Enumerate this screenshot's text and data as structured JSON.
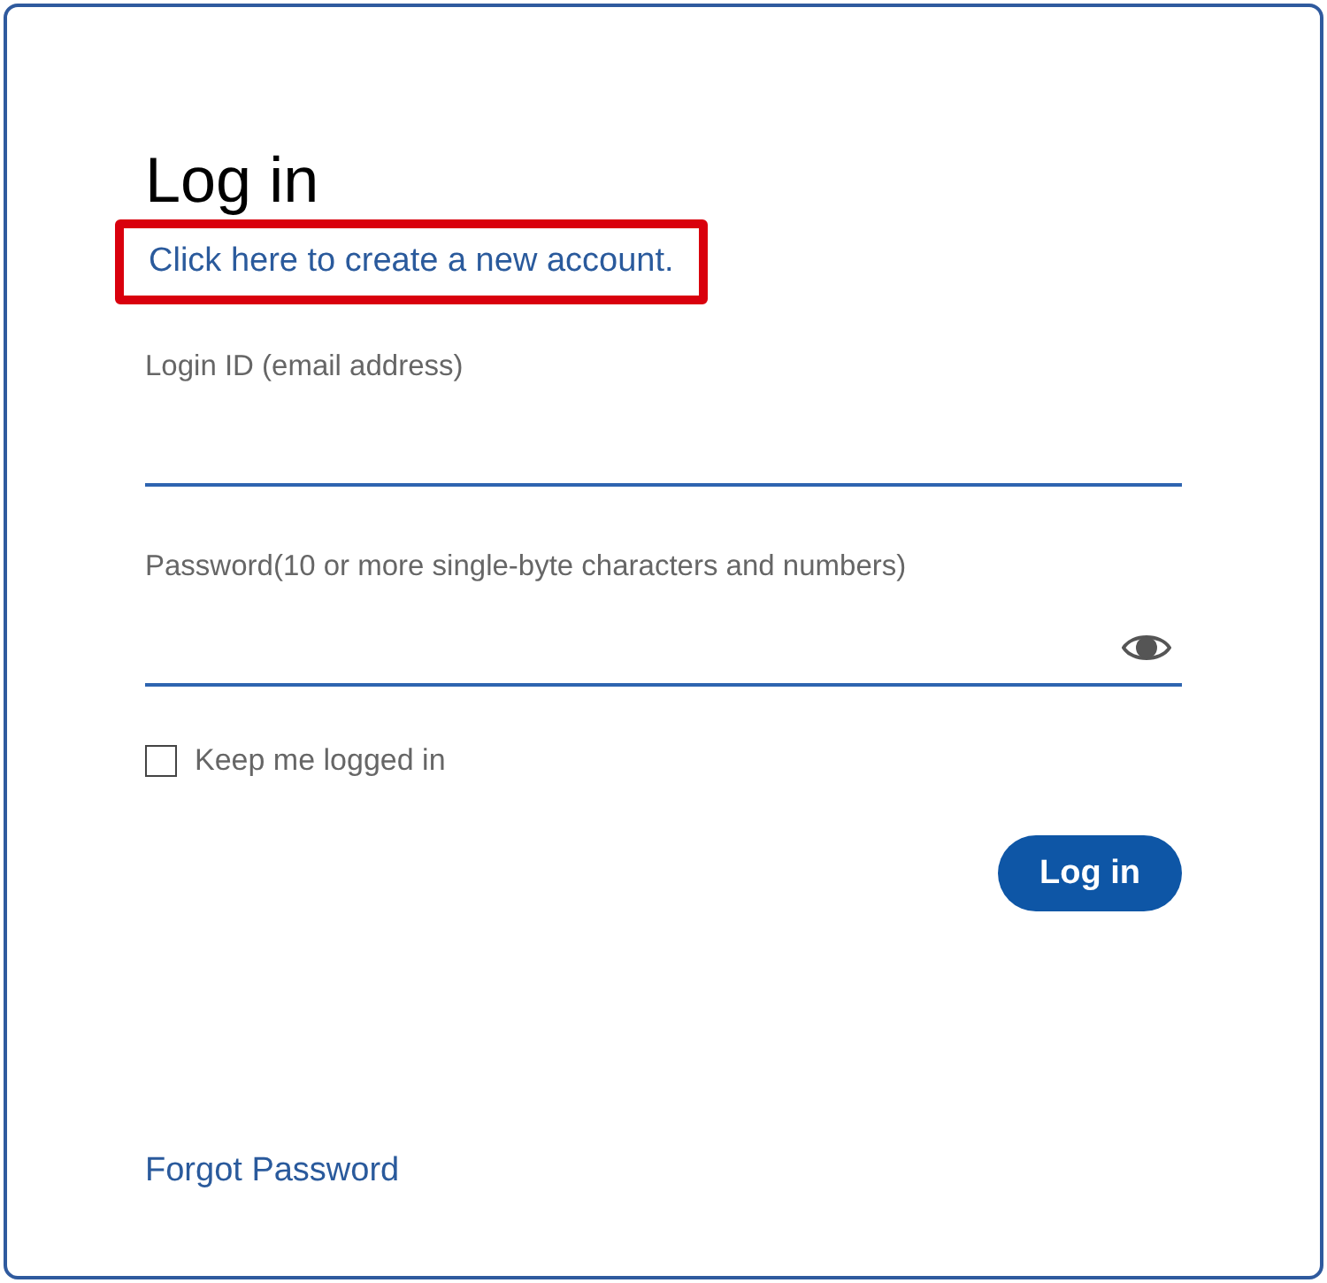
{
  "title": "Log in",
  "create_account_link": {
    "text": "Click here to create a new account.",
    "highlighted": true
  },
  "fields": [
    {
      "kind": "text",
      "label": "Login ID (email address)"
    },
    {
      "kind": "password",
      "label": "Password(10 or more single-byte characters and numbers)"
    }
  ],
  "keep_logged_in": {
    "label": "Keep me logged in",
    "checked": false
  },
  "submit_button": "Log in",
  "forgot_password_link": "Forgot Password"
}
